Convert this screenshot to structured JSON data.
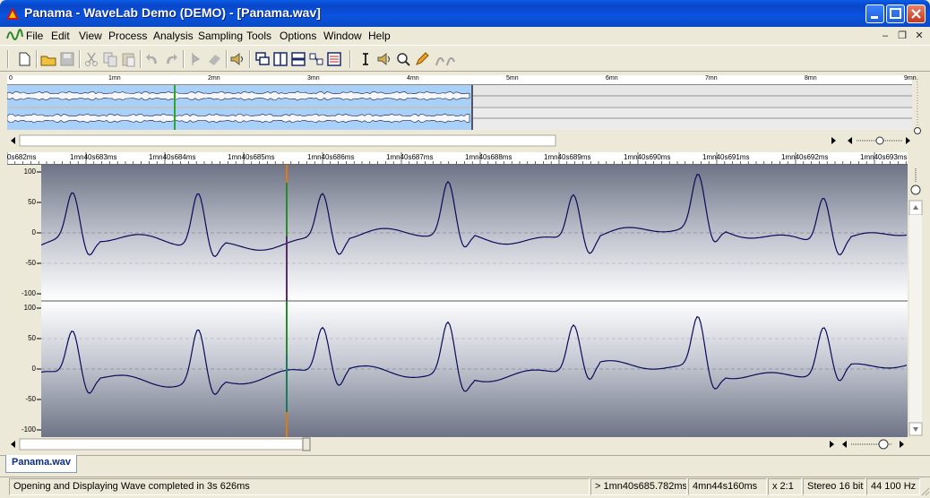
{
  "window": {
    "title": "Panama - WaveLab Demo (DEMO) - [Panama.wav]"
  },
  "menu": [
    "File",
    "Edit",
    "View",
    "Process",
    "Analysis",
    "Sampling",
    "Tools",
    "Options",
    "Window",
    "Help"
  ],
  "toolbar_icons": [
    "new-file-icon",
    "open-folder-icon",
    "save-icon",
    "cut-icon",
    "copy-icon",
    "paste-icon",
    "undo-icon",
    "redo-icon",
    "play-tool-icon",
    "erase-icon",
    "speaker-icon",
    "windows-cascade-icon",
    "split-vertical-icon",
    "split-horizontal-icon",
    "arrange-icon",
    "list-icon",
    "cursor-tool-icon",
    "speaker-tool-icon",
    "zoom-tool-icon",
    "pencil-tool-icon",
    "play-tool-icon-2"
  ],
  "overview": {
    "ruler_labels": [
      "0",
      "1mn",
      "2mn",
      "3mn",
      "4mn",
      "5mn",
      "6mn",
      "7mn",
      "8mn",
      "9mn"
    ]
  },
  "main_view": {
    "ruler_labels": [
      "0s682ms",
      "1mn40s683ms",
      "1mn40s684ms",
      "1mn40s685ms",
      "1mn40s686ms",
      "1mn40s687ms",
      "1mn40s688ms",
      "1mn40s689ms",
      "1mn40s690ms",
      "1mn40s691ms",
      "1mn40s692ms",
      "1mn40s693ms"
    ],
    "y_labels_top": [
      "100",
      "50",
      "0",
      "-50",
      "-100"
    ],
    "y_labels_bottom": [
      "100",
      "50",
      "0",
      "-50",
      "-100"
    ]
  },
  "document_tab": "Panama.wav",
  "status": {
    "message": "Opening and Displaying Wave completed in 3s 626ms",
    "cursor_position": "> 1mn40s685.782ms",
    "length": "4mn44s160ms",
    "zoom": "x 2:1",
    "format": "Stereo 16 bit",
    "sample_rate": "44 100 Hz"
  },
  "colors": {
    "title_bar": "#0a53df",
    "wave_line": "#0a0a5a",
    "cursor": "#e07a10",
    "overview_selection": "#a8d0f8"
  }
}
